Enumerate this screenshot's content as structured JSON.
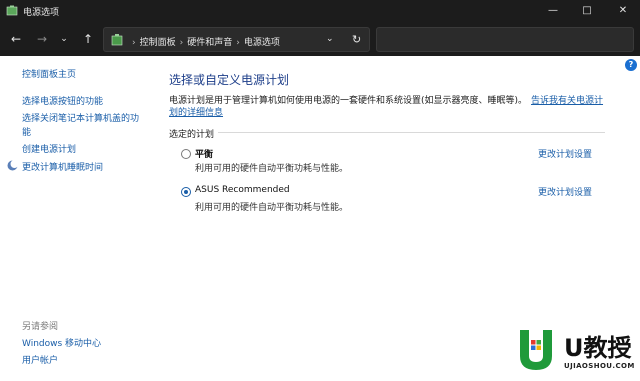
{
  "window": {
    "title": "电源选项",
    "minimize": "—",
    "maximize": "□",
    "close": "✕"
  },
  "nav": {
    "back": "←",
    "forward": "→",
    "recent": "⌄",
    "up": "↑"
  },
  "address": {
    "crumbs": [
      "控制面板",
      "硬件和声音",
      "电源选项"
    ],
    "sep": "›",
    "dropdown": "⌄",
    "refresh": "↻"
  },
  "sidebar": {
    "home": "控制面板主页",
    "items": [
      "选择电源按钮的功能",
      "选择关闭笔记本计算机盖的功",
      "能",
      "创建电源计划",
      "更改计算机睡眠时间"
    ],
    "see_also_label": "另请参阅",
    "see_also": [
      "Windows 移动中心",
      "用户帐户"
    ]
  },
  "main": {
    "title": "选择或自定义电源计划",
    "description": "电源计划是用于管理计算机如何使用电源的一套硬件和系统设置(如显示器亮度、睡眠等)。",
    "help_link_line1": "告诉我有关电源计",
    "help_link_line2": "划的详细信息",
    "group_label": "选定的计划",
    "plans": [
      {
        "name": "平衡",
        "description": "利用可用的硬件自动平衡功耗与性能。",
        "link": "更改计划设置",
        "selected": false
      },
      {
        "name": "ASUS Recommended",
        "description": "利用可用的硬件自动平衡功耗与性能。",
        "link": "更改计划设置",
        "selected": true
      }
    ],
    "help_button": "?"
  },
  "watermark": {
    "text": "U教授",
    "sub": "UJIAOSHOU.COM"
  },
  "colors": {
    "link": "#1a5ea8",
    "title": "#1e3f8a",
    "titlebar": "#1c1c1c"
  }
}
